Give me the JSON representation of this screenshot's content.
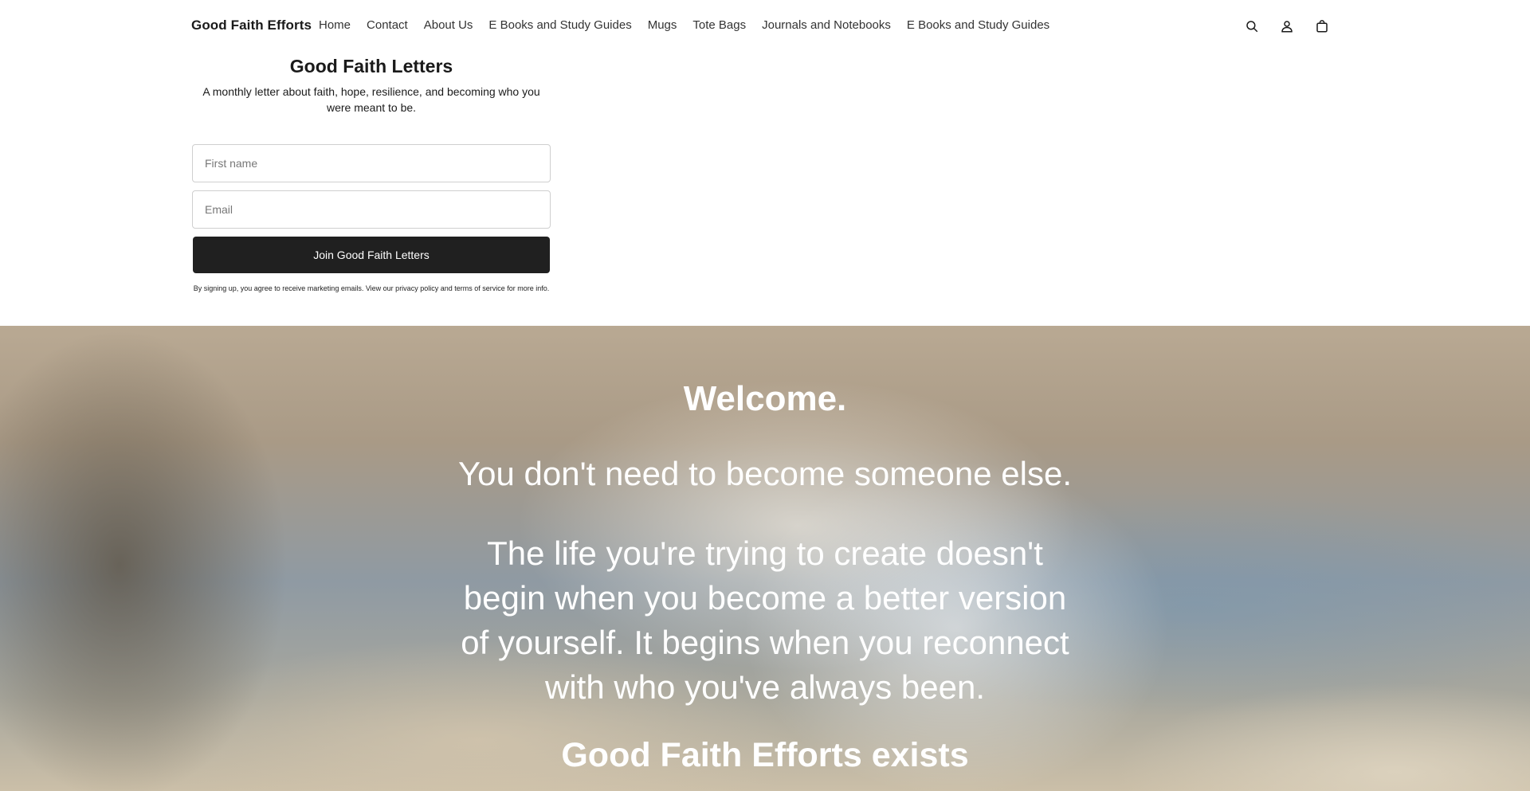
{
  "header": {
    "brand": "Good Faith Efforts",
    "nav": [
      {
        "label": "Home"
      },
      {
        "label": "Contact"
      },
      {
        "label": "About Us"
      },
      {
        "label": "E Books and Study Guides"
      },
      {
        "label": "Mugs"
      },
      {
        "label": "Tote Bags"
      },
      {
        "label": "Journals and Notebooks"
      },
      {
        "label": "E Books and Study Guides"
      }
    ],
    "icons": [
      "search-icon",
      "account-icon",
      "cart-icon"
    ]
  },
  "newsletter": {
    "title": "Good Faith Letters",
    "subtitle": "A monthly letter about faith, hope, resilience, and becoming who you were meant to be.",
    "first_name_placeholder": "First name",
    "first_name_value": "",
    "email_placeholder": "Email",
    "email_value": "",
    "button_label": "Join Good Faith Letters",
    "legal": "By signing up, you agree to receive marketing emails. View our privacy policy and terms of service for more info."
  },
  "hero": {
    "welcome": "Welcome.",
    "line1": "You don't need to become someone else.",
    "paragraph": "The life you're trying to create doesn't begin when you become a better version of yourself. It begins when you reconnect with who you've always been.",
    "heading": "Good Faith Efforts exists"
  },
  "colors": {
    "button_bg": "#202020",
    "hero_text": "#ffffff"
  }
}
